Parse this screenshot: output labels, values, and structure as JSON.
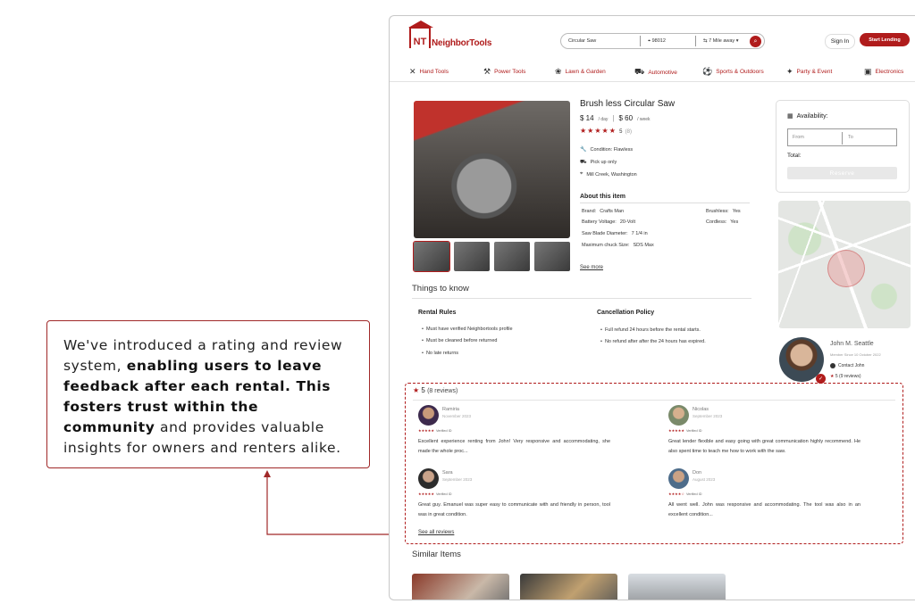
{
  "annotation": {
    "text_plain_1": "We've introduced a rating and review system, ",
    "text_bold": "enabling users to leave feedback after each rental. This fosters trust within the community",
    "text_plain_2": " and provides valuable insights for owners and renters alike."
  },
  "header": {
    "logo_mark": "NT",
    "logo_text": "NeighborTools",
    "search_query": "Circular Saw",
    "zip": "98012",
    "distance": "7 Mile away",
    "signin": "Sign In",
    "start_lending": "Start Lending"
  },
  "nav": [
    {
      "label": "Hand Tools",
      "icon": "hand-tools-icon"
    },
    {
      "label": "Power Tools",
      "icon": "power-tools-icon"
    },
    {
      "label": "Lawn & Garden",
      "icon": "lawn-garden-icon"
    },
    {
      "label": "Automotive",
      "icon": "car-icon"
    },
    {
      "label": "Sports & Outdoors",
      "icon": "sports-icon"
    },
    {
      "label": "Party & Event",
      "icon": "party-icon"
    },
    {
      "label": "Electronics",
      "icon": "electronics-icon"
    }
  ],
  "product": {
    "title": "Brush less Circular Saw",
    "price_day": "$ 14",
    "price_day_unit": "/ day",
    "price_week": "$ 60",
    "price_week_unit": "/ week",
    "stars": "★★★★★",
    "rating": "5",
    "rating_count": "(8)",
    "condition": "Condition: Flawless",
    "pickup": "Pick up only",
    "location": "Mill Creek, Washington",
    "about_title": "About this item",
    "specs": [
      {
        "label": "Brand:",
        "value": "Crafts Man"
      },
      {
        "label": "Battery Voltage:",
        "value": "20-Volt"
      },
      {
        "label": "Saw Blade Diameter:",
        "value": "7 1/4 in"
      },
      {
        "label": "Maximum chuck Size:",
        "value": "SDS Max"
      },
      {
        "label": "Brushless:",
        "value": "Yes"
      },
      {
        "label": "Cordless:",
        "value": "Yes"
      }
    ],
    "see_more": "See more"
  },
  "things_to_know": {
    "title": "Things to know",
    "rental_rules_title": "Rental Rules",
    "rental_rules": [
      "Must have verified Neighbortools profile",
      "Must be cleaned before returned",
      "No late returns"
    ],
    "cancellation_title": "Cancellation Policy",
    "cancellation": [
      "Full refund 24 hours before the rental starts.",
      "No refund after after the 24 hours has expired."
    ]
  },
  "booking": {
    "availability": "Availability:",
    "from_placeholder": "From",
    "to_placeholder": "To",
    "total": "Total:",
    "reserve": "Reserve"
  },
  "owner": {
    "name": "John M. Seattle",
    "since": "Member Since 10 October 2022",
    "contact": "Contact John",
    "rating": "5 (9 reviews)"
  },
  "reviews": {
    "summary_rating": "5",
    "summary_count": "(8 reviews)",
    "verified": "Verified ID",
    "items": [
      {
        "name": "Ramiria",
        "date": "November 2023",
        "stars": "★★★★★",
        "text": "Excellent experience renting from John! Very responsive and accommodating, she made the whole proc..."
      },
      {
        "name": "Nicolas",
        "date": "September 2023",
        "stars": "★★★★★",
        "text": "Great lender flexible and easy going with great communication highly recommend. He also spent time to teach me how to work with the saw."
      },
      {
        "name": "Sara",
        "date": "September 2023",
        "stars": "★★★★★",
        "text": "Great guy. Emanuel was super easy to communicate with and friendly in person, tool was in great condition."
      },
      {
        "name": "Don",
        "date": "August 2023",
        "stars": "★★★★☆",
        "text": "All went well. John was responsive and accommodating. The tool was also in an excellent condition..."
      }
    ],
    "see_all": "See all reviews"
  },
  "similar": {
    "title": "Similar Items"
  },
  "colors": {
    "brand": "#b01c1c",
    "annotation_border": "#a02828"
  }
}
